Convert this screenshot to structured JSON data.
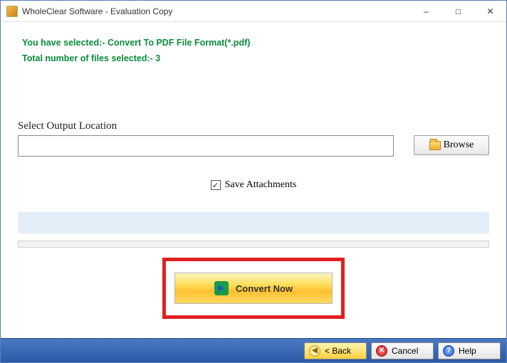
{
  "window": {
    "title": "WholeClear Software - Evaluation Copy"
  },
  "info": {
    "selected_line": "You have selected:- Convert To PDF File Format(*.pdf)",
    "count_line": "Total number of files selected:- 3"
  },
  "output": {
    "label": "Select Output Location",
    "value": "",
    "browse_label": "Browse"
  },
  "save_attachments": {
    "label": "Save Attachments",
    "checked": true
  },
  "convert": {
    "label": "Convert Now"
  },
  "footer": {
    "back": "< Back",
    "cancel": "Cancel",
    "help": "Help"
  }
}
